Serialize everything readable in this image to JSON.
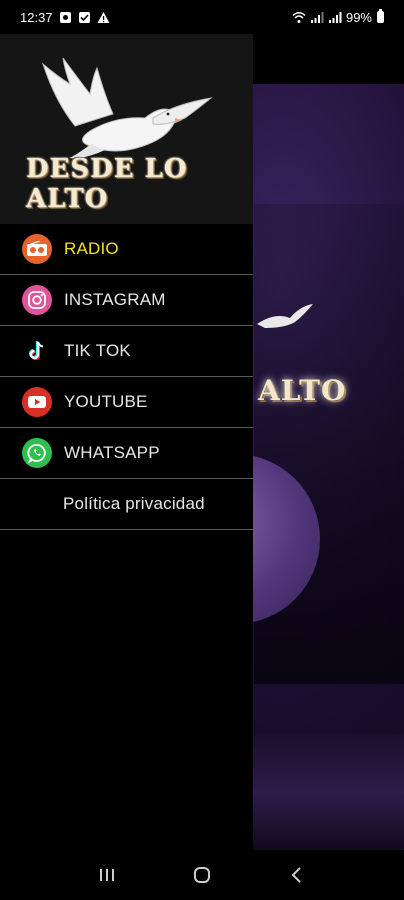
{
  "status_bar": {
    "time": "12:37",
    "battery": "99%"
  },
  "app_background": {
    "logo_text": "ALTO"
  },
  "drawer": {
    "logo_text": "DESDE LO ALTO",
    "items": [
      {
        "label": "RADIO",
        "icon": "radio-icon",
        "active": true
      },
      {
        "label": "INSTAGRAM",
        "icon": "instagram-icon",
        "active": false
      },
      {
        "label": "TIK TOK",
        "icon": "tiktok-icon",
        "active": false
      },
      {
        "label": "YOUTUBE",
        "icon": "youtube-icon",
        "active": false
      },
      {
        "label": "WHATSAPP",
        "icon": "whatsapp-icon",
        "active": false
      },
      {
        "label": "Política privacidad",
        "icon": "",
        "active": false
      }
    ]
  },
  "colors": {
    "active": "#f4e020",
    "text": "#e6e6e6",
    "divider": "#5a5a5a"
  }
}
